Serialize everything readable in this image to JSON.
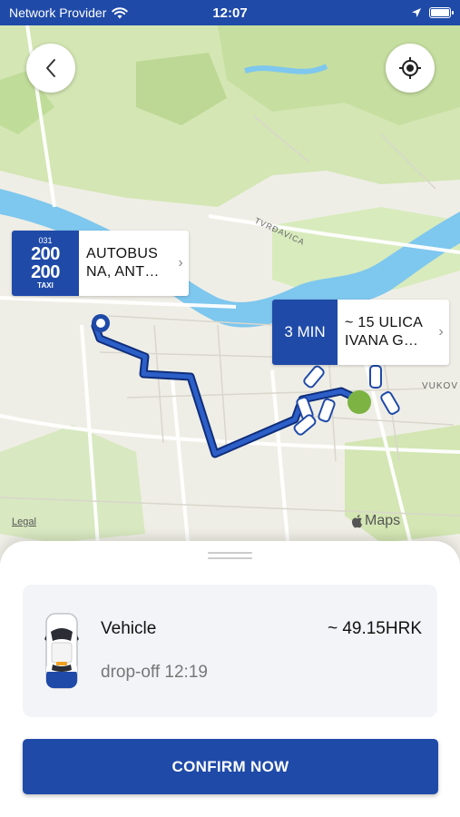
{
  "status_bar": {
    "carrier": "Network Provider",
    "time": "12:07",
    "wifi_icon": "wifi-icon",
    "location_icon": "location-arrow-icon",
    "battery_icon": "battery-icon"
  },
  "map": {
    "street_labels": [
      "TVRĐAVICA",
      "VUKOV"
    ],
    "legal_label": "Legal",
    "brand_label": "Maps",
    "back_icon": "chevron-left-icon",
    "locate_icon": "crosshair-icon",
    "origin": {
      "logo_code": "031",
      "logo_number_top": "200",
      "logo_number_bottom": "200",
      "logo_text": "TAXI",
      "address_line1": "AUTOBUS",
      "address_line2": "NA, ANT…"
    },
    "destination": {
      "eta": "3 MIN",
      "address_line1": "~ 15 ULICA",
      "address_line2": "IVANA G…"
    },
    "route_color": "#1f4aa8"
  },
  "sheet": {
    "vehicle_name": "Vehicle",
    "drop_off": "drop-off 12:19",
    "price": "~ 49.15HRK",
    "confirm_label": "CONFIRM NOW"
  },
  "colors": {
    "brand_blue": "#1f4aa8",
    "map_land": "#efeee6",
    "map_green": "#d3e6b3",
    "map_water": "#7ec7ee"
  }
}
